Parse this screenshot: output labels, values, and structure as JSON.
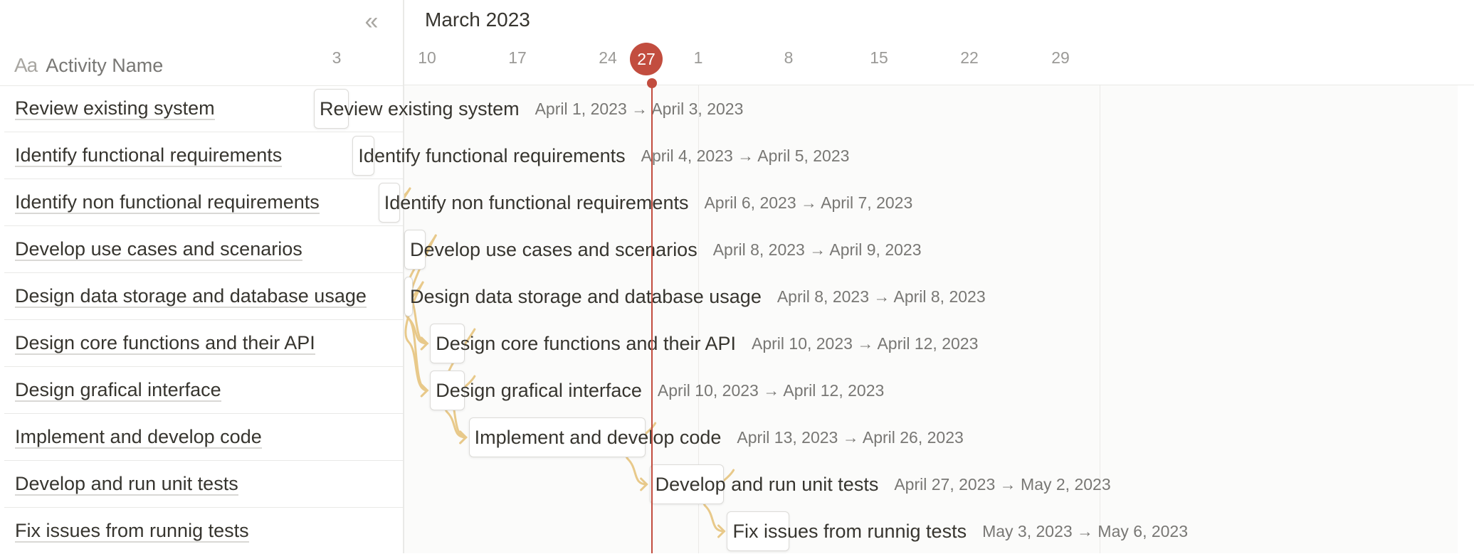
{
  "sidebar": {
    "collapse_icon": "double-chevron-left-icon",
    "column_icon": "Aa",
    "column_label": "Activity Name"
  },
  "timeline": {
    "month": "March 2023",
    "days": [
      "3",
      "10",
      "17",
      "24",
      "1",
      "8",
      "15",
      "22",
      "29"
    ],
    "today": "27",
    "today_color": "#c24d3f",
    "dependency_color": "#e8c98a"
  },
  "tasks": [
    {
      "name": "Review existing system",
      "dates": "April 1, 2023 → April 3, 2023"
    },
    {
      "name": "Identify functional requirements",
      "dates": "April 4, 2023 → April 5, 2023"
    },
    {
      "name": "Identify non functional requirements",
      "dates": "April 6, 2023 → April 7, 2023"
    },
    {
      "name": "Develop use cases and scenarios",
      "dates": "April 8, 2023 → April 9, 2023"
    },
    {
      "name": "Design data storage and database usage",
      "dates": "April 8, 2023 → April 8, 2023"
    },
    {
      "name": "Design core functions and their API",
      "dates": "April 10, 2023 → April 12, 2023"
    },
    {
      "name": "Design grafical interface",
      "dates": "April 10, 2023 → April 12, 2023"
    },
    {
      "name": "Implement and develop code",
      "dates": "April 13, 2023 → April 26, 2023"
    },
    {
      "name": "Develop and run unit tests",
      "dates": "April 27, 2023 → May 2, 2023"
    },
    {
      "name": "Fix issues from runnig tests",
      "dates": "May 3, 2023 → May 6, 2023"
    }
  ]
}
